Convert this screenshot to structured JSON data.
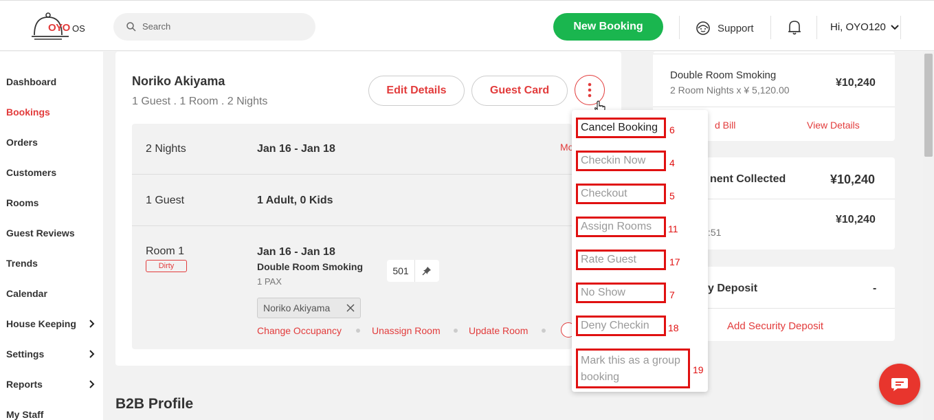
{
  "header": {
    "logo_text": "OYO",
    "logo_suffix": "OS",
    "search_placeholder": "Search",
    "new_booking_label": "New Booking",
    "support_label": "Support",
    "user_label": "Hi, OYO120"
  },
  "sidebar": {
    "items": [
      {
        "label": "Dashboard"
      },
      {
        "label": "Bookings",
        "active": true
      },
      {
        "label": "Orders"
      },
      {
        "label": "Customers"
      },
      {
        "label": "Rooms"
      },
      {
        "label": "Guest Reviews"
      },
      {
        "label": "Trends"
      },
      {
        "label": "Calendar"
      },
      {
        "label": "House Keeping",
        "chevron": true
      },
      {
        "label": "Settings",
        "chevron": true
      },
      {
        "label": "Reports",
        "chevron": true
      },
      {
        "label": "My Staff"
      }
    ]
  },
  "booking": {
    "guest_name": "Noriko Akiyama",
    "summary": "1 Guest . 1 Room . 2 Nights",
    "edit_details": "Edit Details",
    "guest_card": "Guest Card",
    "nights_label": "2 Nights",
    "dates": "Jan 16 - Jan 18",
    "more_partial": "Mo",
    "guests_label": "1 Guest",
    "guests_detail": "1 Adult, 0 Kids",
    "room_label": "Room 1",
    "room_status": "Dirty",
    "room_dates": "Jan 16 - Jan 18",
    "room_type": "Double Room Smoking",
    "pax": "1 PAX",
    "room_number": "501",
    "guest_chip": "Noriko Akiyama",
    "actions": {
      "change_occupancy": "Change Occupancy",
      "unassign_room": "Unassign Room",
      "update_room": "Update Room"
    }
  },
  "b2b_title": "B2B Profile",
  "dropdown": {
    "items": [
      {
        "label": "Cancel Booking",
        "num": "6"
      },
      {
        "label": "Checkin Now",
        "num": "4"
      },
      {
        "label": "Checkout",
        "num": "5"
      },
      {
        "label": "Assign Rooms",
        "num": "11"
      },
      {
        "label": "Rate Guest",
        "num": "17"
      },
      {
        "label": "No Show",
        "num": "7"
      },
      {
        "label": "Deny Checkin",
        "num": "18"
      },
      {
        "label": "Mark this as a group booking",
        "line1": "Mark this as a group",
        "line2": "booking",
        "num": "19"
      }
    ]
  },
  "right_panel": {
    "room_type": "Double Room Smoking",
    "room_nights": "2 Room Nights x ¥ 5,120.00",
    "room_total": "¥10,240",
    "bill_partial": "d Bill",
    "view_details": "View Details",
    "payment_partial": "nent Collected",
    "payment_amount": "¥10,240",
    "payment_row_amount": "¥10,240",
    "payment_time_partial": ":51",
    "deposit_partial": "y Deposit",
    "deposit_value": "-",
    "add_deposit": "Add Security Deposit"
  }
}
